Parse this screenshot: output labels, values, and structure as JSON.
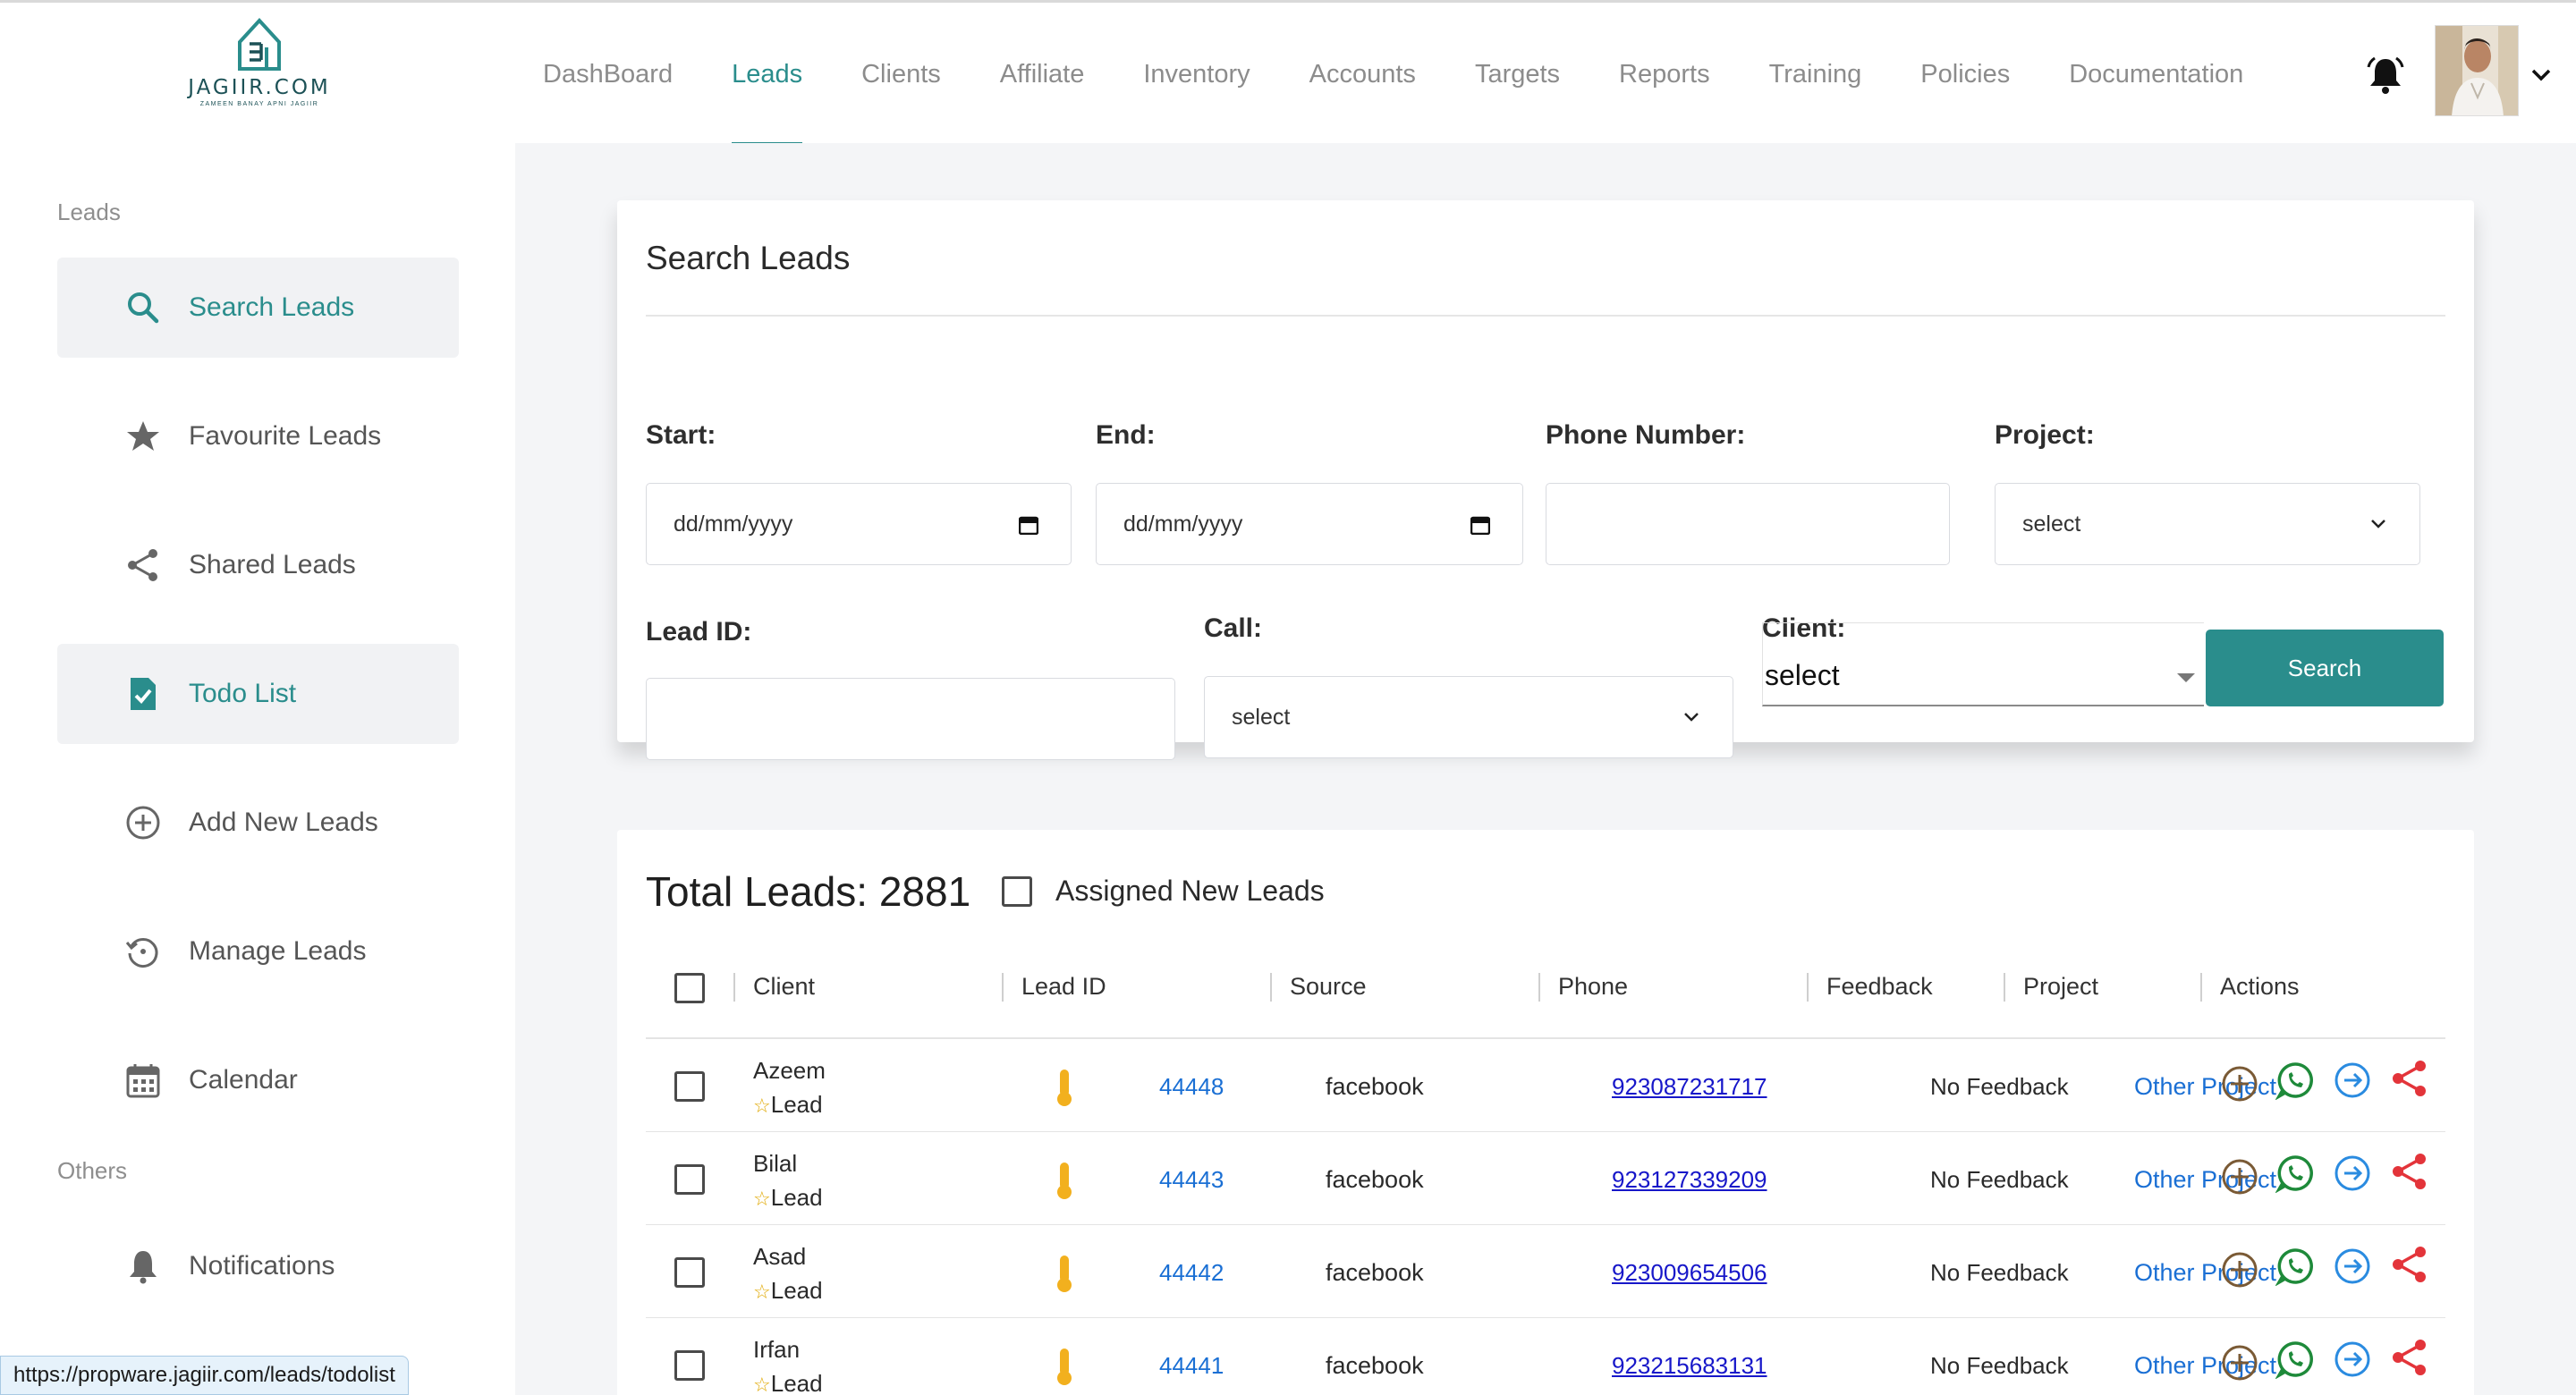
{
  "brand": {
    "name": "JAGIIR.COM",
    "tagline": "ZAMEEN BANAY APNI JAGIIR"
  },
  "nav": {
    "items": [
      "DashBoard",
      "Leads",
      "Clients",
      "Affiliate",
      "Inventory",
      "Accounts",
      "Targets",
      "Reports",
      "Training",
      "Policies",
      "Documentation"
    ],
    "active": "Leads"
  },
  "sidebar": {
    "heading_leads": "Leads",
    "heading_others": "Others",
    "items": [
      {
        "label": "Search Leads",
        "icon": "search-icon"
      },
      {
        "label": "Favourite Leads",
        "icon": "star-icon"
      },
      {
        "label": "Shared Leads",
        "icon": "share-icon"
      },
      {
        "label": "Todo List",
        "icon": "todo-icon"
      },
      {
        "label": "Add New Leads",
        "icon": "plus-circle-icon"
      },
      {
        "label": "Manage Leads",
        "icon": "history-icon"
      },
      {
        "label": "Calendar",
        "icon": "calendar-icon"
      }
    ],
    "notifications": "Notifications"
  },
  "search": {
    "title": "Search Leads",
    "start_label": "Start:",
    "start_value": "dd/mm/yyyy",
    "end_label": "End:",
    "end_value": "dd/mm/yyyy",
    "phone_label": "Phone Number:",
    "project_label": "Project:",
    "project_value": "select",
    "leadid_label": "Lead ID:",
    "call_label": "Call:",
    "call_value": "select",
    "client_label": "Client:",
    "client_value": "select",
    "button": "Search"
  },
  "table": {
    "total": "Total Leads: 2881",
    "assigned_label": "Assigned New Leads",
    "columns": [
      "Client",
      "Lead ID",
      "Source",
      "Phone",
      "Feedback",
      "Project",
      "Actions"
    ],
    "rows": [
      {
        "name": "Azeem",
        "type": "Lead",
        "lead_id": "44448",
        "source": "facebook",
        "phone": "923087231717",
        "feedback": "No Feedback",
        "project": "Other Project"
      },
      {
        "name": "Bilal",
        "type": "Lead",
        "lead_id": "44443",
        "source": "facebook",
        "phone": "923127339209",
        "feedback": "No Feedback",
        "project": "Other Project"
      },
      {
        "name": "Asad",
        "type": "Lead",
        "lead_id": "44442",
        "source": "facebook",
        "phone": "923009654506",
        "feedback": "No Feedback",
        "project": "Other Project"
      },
      {
        "name": "Irfan",
        "type": "Lead",
        "lead_id": "44441",
        "source": "facebook",
        "phone": "923215683131",
        "feedback": "No Feedback",
        "project": "Other Project"
      }
    ]
  },
  "status_url": "https://propware.jagiir.com/leads/todolist",
  "colors": {
    "accent": "#2a8d8c",
    "link": "#1a6fd4",
    "phone_link": "#1717c9",
    "whatsapp": "#1e8a3a",
    "share": "#e3343a",
    "add": "#7a5a35",
    "thermometer": "#f2b01e"
  }
}
